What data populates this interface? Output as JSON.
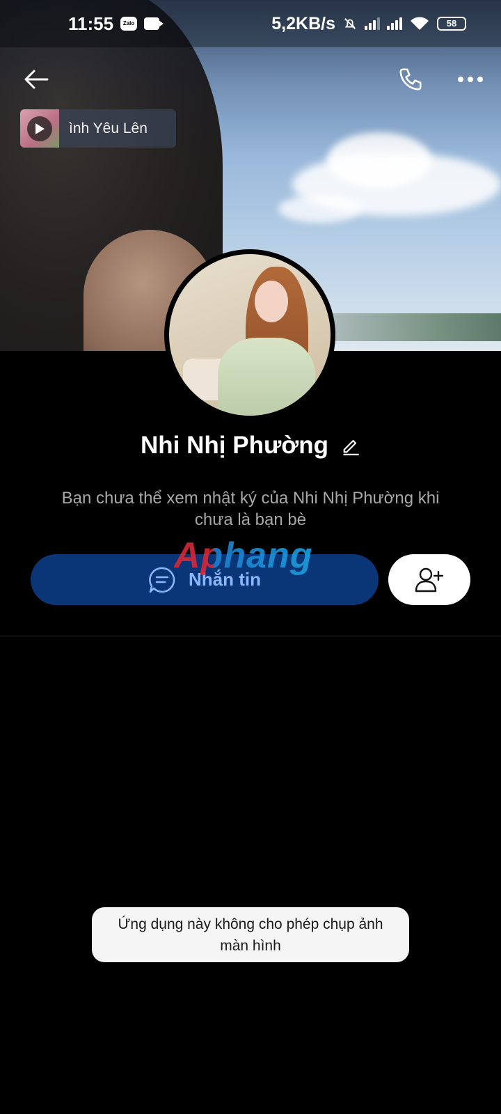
{
  "status_bar": {
    "time": "11:55",
    "app_badge": "Zalo",
    "net_speed": "5,2KB/s",
    "battery": "58",
    "icons": [
      "zalo-icon",
      "video-call-icon",
      "bell-muted-icon",
      "signal-icon",
      "signal-icon",
      "wifi-icon",
      "battery-icon"
    ]
  },
  "header": {
    "back_icon": "arrow-left-icon",
    "call_icon": "phone-icon",
    "more_icon": "more-horizontal-icon"
  },
  "music": {
    "title": "ình Yêu Lên",
    "icon": "play-icon"
  },
  "profile": {
    "name": "Nhi Nhị Phường",
    "edit_icon": "pencil-icon",
    "info": "Bạn chưa thể xem nhật ký của Nhi Nhị Phường khi chưa là bạn bè"
  },
  "actions": {
    "message_label": "Nhắn tin",
    "message_icon": "chat-bubble-icon",
    "add_friend_icon": "add-user-icon"
  },
  "watermark": "Aphang",
  "toast": {
    "text": "Ứng dụng này không cho phép chụp ảnh màn hình"
  },
  "colors": {
    "background": "#000000",
    "message_button": "#0a3576",
    "message_text": "#8ab8ff",
    "toast_bg": "#f5f5f5"
  }
}
